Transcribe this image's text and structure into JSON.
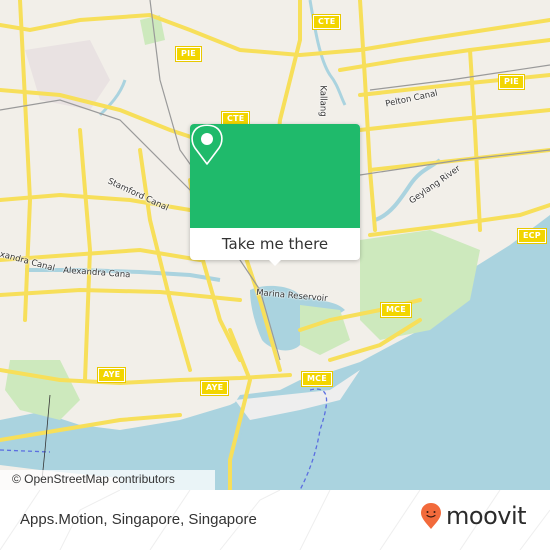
{
  "map": {
    "highway_shields": [
      {
        "label": "CTE",
        "pos": "top-center"
      },
      {
        "label": "PIE",
        "pos": "top-left"
      },
      {
        "label": "CTE",
        "pos": "center-upper"
      },
      {
        "label": "PIE",
        "pos": "top-right"
      },
      {
        "label": "ECP",
        "pos": "right"
      },
      {
        "label": "MCE",
        "pos": "right-center"
      },
      {
        "label": "MCE",
        "pos": "bottom-center"
      },
      {
        "label": "AYE",
        "pos": "bottom-left"
      },
      {
        "label": "AYE",
        "pos": "bottom-center-left"
      }
    ],
    "labels": {
      "geylang_river": "Geylang River",
      "alexandra_canal_1": "Alexandra Canal",
      "alexandra_canal_2": "Alexandra Cana",
      "marina_reservoir": "Marina Reservoir",
      "kallang": "Kallang",
      "stamford_canal": "Stamford Canal",
      "pelton_canal": "Pelton Canal"
    },
    "colors": {
      "land": "#f2efe9",
      "water": "#aad3df",
      "road": "#f7df5a",
      "park": "#c8e6b4",
      "rail": "#9a9a9a",
      "ferry": "#5b6ee0"
    }
  },
  "popup": {
    "icon": "map-pin-icon",
    "button_label": "Take me there",
    "color": "#1fba6b"
  },
  "attribution": "© OpenStreetMap contributors",
  "footer": {
    "place_name": "Apps.Motion, Singapore, Singapore",
    "brand": "moovit",
    "brand_color": "#f26a3b"
  }
}
